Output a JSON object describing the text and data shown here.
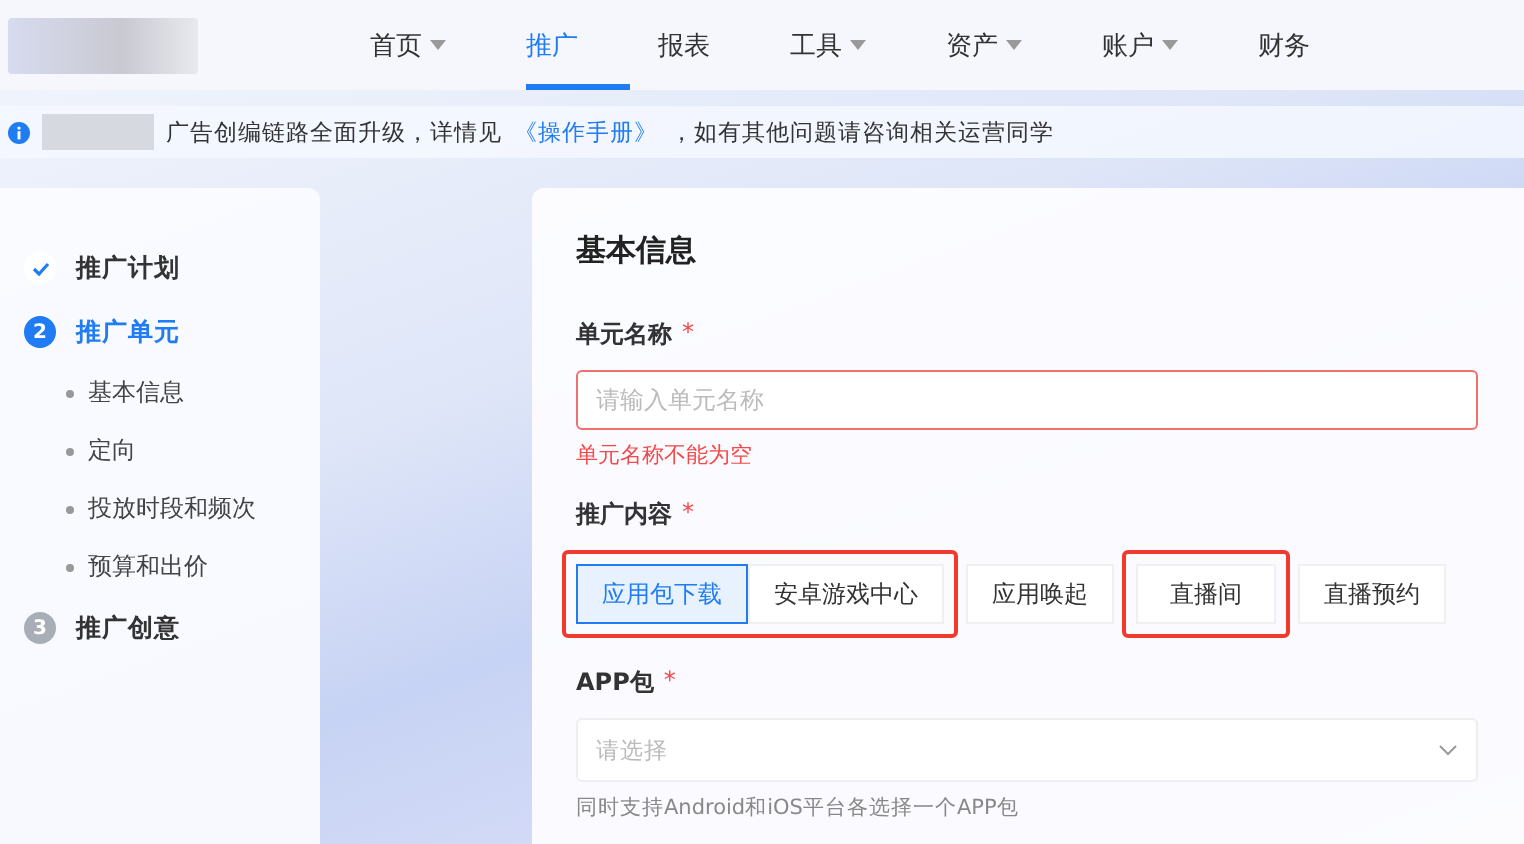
{
  "nav": {
    "items": [
      {
        "label": "首页",
        "has_menu": true,
        "selected": false
      },
      {
        "label": "推广",
        "has_menu": false,
        "selected": true
      },
      {
        "label": "报表",
        "has_menu": false,
        "selected": false
      },
      {
        "label": "工具",
        "has_menu": true,
        "selected": false
      },
      {
        "label": "资产",
        "has_menu": true,
        "selected": false
      },
      {
        "label": "账户",
        "has_menu": true,
        "selected": false
      },
      {
        "label": "财务",
        "has_menu": false,
        "selected": false
      }
    ]
  },
  "notice": {
    "text": "广告创编链路全面升级，详情见",
    "link": "《操作手册》",
    "suffix": "，如有其他问题请咨询相关运营同学"
  },
  "steps": [
    {
      "label": "推广计划",
      "done": true,
      "selected": false
    },
    {
      "label": "推广单元",
      "done": false,
      "selected": true,
      "marker": "2",
      "children": [
        {
          "label": "基本信息"
        },
        {
          "label": "定向"
        },
        {
          "label": "投放时段和频次"
        },
        {
          "label": "预算和出价"
        }
      ]
    },
    {
      "label": "推广创意",
      "done": false,
      "selected": false,
      "marker": "3"
    }
  ],
  "form": {
    "title": "基本信息",
    "unit_name": {
      "label": "单元名称",
      "required_mark": "*",
      "placeholder": "请输入单元名称",
      "error": "单元名称不能为空"
    },
    "content": {
      "label": "推广内容",
      "required_mark": "*",
      "option_groups": [
        {
          "highlighted": true,
          "options": [
            {
              "label": "应用包下载",
              "selected": true
            },
            {
              "label": "安卓游戏中心",
              "selected": false
            }
          ]
        },
        {
          "highlighted": false,
          "options": [
            {
              "label": "应用唤起",
              "selected": false
            }
          ]
        },
        {
          "highlighted": true,
          "options": [
            {
              "label": "直播间",
              "selected": false
            }
          ]
        },
        {
          "highlighted": false,
          "options": [
            {
              "label": "直播预约",
              "selected": false
            }
          ]
        }
      ]
    },
    "app": {
      "label": "APP包",
      "required_mark": "*",
      "placeholder": "请选择",
      "hint": "同时支持Android和iOS平台各选择一个APP包"
    }
  }
}
